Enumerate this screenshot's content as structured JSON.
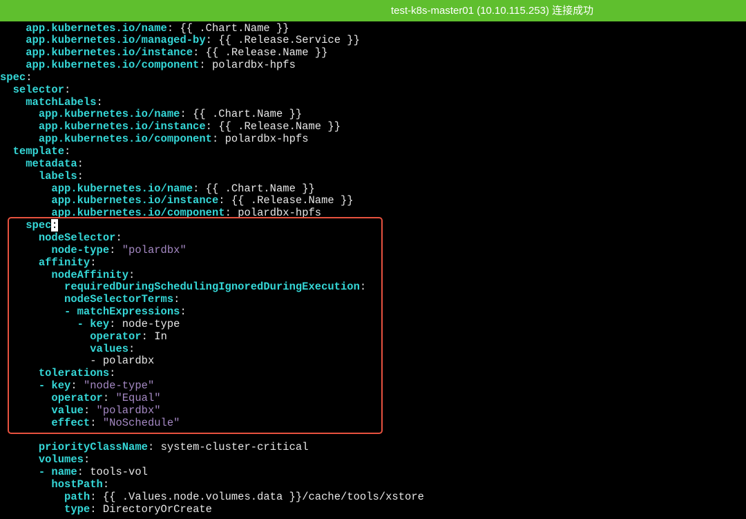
{
  "connection_banner": {
    "text": "test-k8s-master01 (10.10.115.253) 连接成功",
    "color": "#5fbf2e"
  },
  "colors": {
    "key": "#35d7d7",
    "plain": "#e6e6e6",
    "string": "#a589c4",
    "highlight_border": "#e8523f",
    "background": "#000000"
  },
  "terminal_lines": [
    [
      {
        "t": "    "
      },
      {
        "t": "app.kubernetes.io/name",
        "c": "k"
      },
      {
        "t": ": "
      },
      {
        "t": "{{ .Chart.Name }}",
        "c": "v"
      }
    ],
    [
      {
        "t": "    "
      },
      {
        "t": "app.kubernetes.io/managed-by",
        "c": "k"
      },
      {
        "t": ": "
      },
      {
        "t": "{{ .Release.Service }}",
        "c": "v"
      }
    ],
    [
      {
        "t": "    "
      },
      {
        "t": "app.kubernetes.io/instance",
        "c": "k"
      },
      {
        "t": ": "
      },
      {
        "t": "{{ .Release.Name }}",
        "c": "v"
      }
    ],
    [
      {
        "t": "    "
      },
      {
        "t": "app.kubernetes.io/component",
        "c": "k"
      },
      {
        "t": ": "
      },
      {
        "t": "polardbx-hpfs",
        "c": "v"
      }
    ],
    [
      {
        "t": "spec",
        "c": "k"
      },
      {
        "t": ":"
      }
    ],
    [
      {
        "t": "  "
      },
      {
        "t": "selector",
        "c": "k"
      },
      {
        "t": ":"
      }
    ],
    [
      {
        "t": "    "
      },
      {
        "t": "matchLabels",
        "c": "k"
      },
      {
        "t": ":"
      }
    ],
    [
      {
        "t": "      "
      },
      {
        "t": "app.kubernetes.io/name",
        "c": "k"
      },
      {
        "t": ": "
      },
      {
        "t": "{{ .Chart.Name }}",
        "c": "v"
      }
    ],
    [
      {
        "t": "      "
      },
      {
        "t": "app.kubernetes.io/instance",
        "c": "k"
      },
      {
        "t": ": "
      },
      {
        "t": "{{ .Release.Name }}",
        "c": "v"
      }
    ],
    [
      {
        "t": "      "
      },
      {
        "t": "app.kubernetes.io/component",
        "c": "k"
      },
      {
        "t": ": "
      },
      {
        "t": "polardbx-hpfs",
        "c": "v"
      }
    ],
    [
      {
        "t": "  "
      },
      {
        "t": "template",
        "c": "k"
      },
      {
        "t": ":"
      }
    ],
    [
      {
        "t": "    "
      },
      {
        "t": "metadata",
        "c": "k"
      },
      {
        "t": ":"
      }
    ],
    [
      {
        "t": "      "
      },
      {
        "t": "labels",
        "c": "k"
      },
      {
        "t": ":"
      }
    ],
    [
      {
        "t": "        "
      },
      {
        "t": "app.kubernetes.io/name",
        "c": "k"
      },
      {
        "t": ": "
      },
      {
        "t": "{{ .Chart.Name }}",
        "c": "v"
      }
    ],
    [
      {
        "t": "        "
      },
      {
        "t": "app.kubernetes.io/instance",
        "c": "k"
      },
      {
        "t": ": "
      },
      {
        "t": "{{ .Release.Name }}",
        "c": "v"
      }
    ],
    [
      {
        "t": "        "
      },
      {
        "t": "app.kubernetes.io/component",
        "c": "k"
      },
      {
        "t": ": "
      },
      {
        "t": "polardbx-hpfs",
        "c": "v"
      }
    ],
    [
      {
        "t": "    "
      },
      {
        "t": "spec",
        "c": "k"
      },
      {
        "t": ":",
        "c": "cursor"
      }
    ],
    [
      {
        "t": "      "
      },
      {
        "t": "nodeSelector",
        "c": "k"
      },
      {
        "t": ":"
      }
    ],
    [
      {
        "t": "        "
      },
      {
        "t": "node-type",
        "c": "k"
      },
      {
        "t": ": "
      },
      {
        "t": "\"polardbx\"",
        "c": "s"
      }
    ],
    [
      {
        "t": "      "
      },
      {
        "t": "affinity",
        "c": "k"
      },
      {
        "t": ":"
      }
    ],
    [
      {
        "t": "        "
      },
      {
        "t": "nodeAffinity",
        "c": "k"
      },
      {
        "t": ":"
      }
    ],
    [
      {
        "t": "          "
      },
      {
        "t": "requiredDuringSchedulingIgnoredDuringExecution",
        "c": "k"
      },
      {
        "t": ":"
      }
    ],
    [
      {
        "t": "          "
      },
      {
        "t": "nodeSelectorTerms",
        "c": "k"
      },
      {
        "t": ":"
      }
    ],
    [
      {
        "t": "          "
      },
      {
        "t": "- ",
        "c": "k"
      },
      {
        "t": "matchExpressions",
        "c": "k"
      },
      {
        "t": ":"
      }
    ],
    [
      {
        "t": "            "
      },
      {
        "t": "- ",
        "c": "k"
      },
      {
        "t": "key",
        "c": "k"
      },
      {
        "t": ": "
      },
      {
        "t": "node-type",
        "c": "v"
      }
    ],
    [
      {
        "t": "              "
      },
      {
        "t": "operator",
        "c": "k"
      },
      {
        "t": ": "
      },
      {
        "t": "In",
        "c": "v"
      }
    ],
    [
      {
        "t": "              "
      },
      {
        "t": "values",
        "c": "k"
      },
      {
        "t": ":"
      }
    ],
    [
      {
        "t": "              "
      },
      {
        "t": "- polardbx",
        "c": "v"
      }
    ],
    [
      {
        "t": "      "
      },
      {
        "t": "tolerations",
        "c": "k"
      },
      {
        "t": ":"
      }
    ],
    [
      {
        "t": "      "
      },
      {
        "t": "- ",
        "c": "k"
      },
      {
        "t": "key",
        "c": "k"
      },
      {
        "t": ": "
      },
      {
        "t": "\"node-type\"",
        "c": "s"
      }
    ],
    [
      {
        "t": "        "
      },
      {
        "t": "operator",
        "c": "k"
      },
      {
        "t": ": "
      },
      {
        "t": "\"Equal\"",
        "c": "s"
      }
    ],
    [
      {
        "t": "        "
      },
      {
        "t": "value",
        "c": "k"
      },
      {
        "t": ": "
      },
      {
        "t": "\"polardbx\"",
        "c": "s"
      }
    ],
    [
      {
        "t": "        "
      },
      {
        "t": "effect",
        "c": "k"
      },
      {
        "t": ": "
      },
      {
        "t": "\"NoSchedule\"",
        "c": "s"
      }
    ],
    [],
    [
      {
        "t": "      "
      },
      {
        "t": "priorityClassName",
        "c": "k"
      },
      {
        "t": ": "
      },
      {
        "t": "system-cluster-critical",
        "c": "v"
      }
    ],
    [
      {
        "t": "      "
      },
      {
        "t": "volumes",
        "c": "k"
      },
      {
        "t": ":"
      }
    ],
    [
      {
        "t": "      "
      },
      {
        "t": "- ",
        "c": "k"
      },
      {
        "t": "name",
        "c": "k"
      },
      {
        "t": ": "
      },
      {
        "t": "tools-vol",
        "c": "v"
      }
    ],
    [
      {
        "t": "        "
      },
      {
        "t": "hostPath",
        "c": "k"
      },
      {
        "t": ":"
      }
    ],
    [
      {
        "t": "          "
      },
      {
        "t": "path",
        "c": "k"
      },
      {
        "t": ": "
      },
      {
        "t": "{{ .Values.node.volumes.data }}/cache/tools/xstore",
        "c": "v"
      }
    ],
    [
      {
        "t": "          "
      },
      {
        "t": "type",
        "c": "k"
      },
      {
        "t": ": "
      },
      {
        "t": "DirectoryOrCreate",
        "c": "v"
      }
    ]
  ]
}
